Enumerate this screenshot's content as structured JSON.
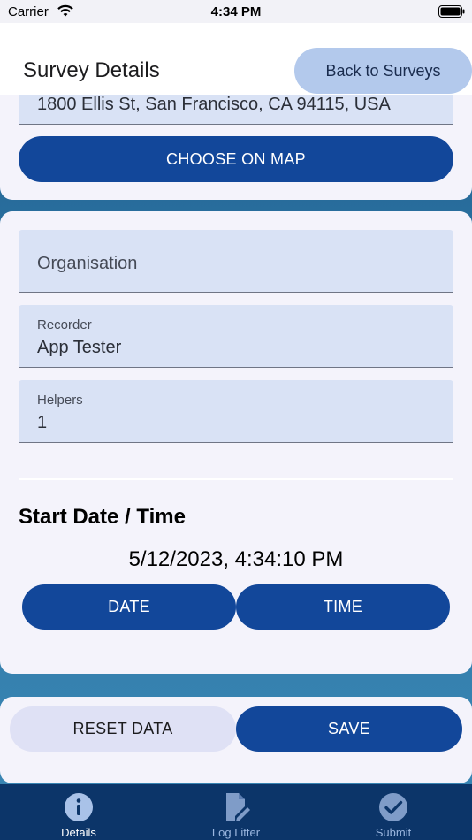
{
  "status_bar": {
    "carrier": "Carrier",
    "time": "4:34 PM"
  },
  "header": {
    "title": "Survey Details",
    "back_label": "Back to Surveys"
  },
  "location": {
    "address": "1800 Ellis St, San Francisco, CA 94115, USA",
    "map_button": "CHOOSE ON MAP"
  },
  "fields": {
    "organisation": {
      "placeholder": "Organisation",
      "value": ""
    },
    "recorder": {
      "label": "Recorder",
      "value": "App Tester"
    },
    "helpers": {
      "label": "Helpers",
      "value": "1"
    }
  },
  "start": {
    "title": "Start Date / Time",
    "datetime": "5/12/2023, 4:34:10 PM",
    "date_button": "DATE",
    "time_button": "TIME"
  },
  "actions": {
    "reset": "RESET DATA",
    "save": "SAVE"
  },
  "tabs": [
    {
      "label": "Details",
      "icon": "info-icon",
      "active": true
    },
    {
      "label": "Log Litter",
      "icon": "edit-document-icon",
      "active": false
    },
    {
      "label": "Submit",
      "icon": "check-circle-icon",
      "active": false
    }
  ],
  "colors": {
    "primary": "#12479a",
    "header_button": "#b3c9ec",
    "tab_bar": "#0c3569",
    "field_bg": "#d9e2f5",
    "card_bg": "#f4f3fb"
  }
}
